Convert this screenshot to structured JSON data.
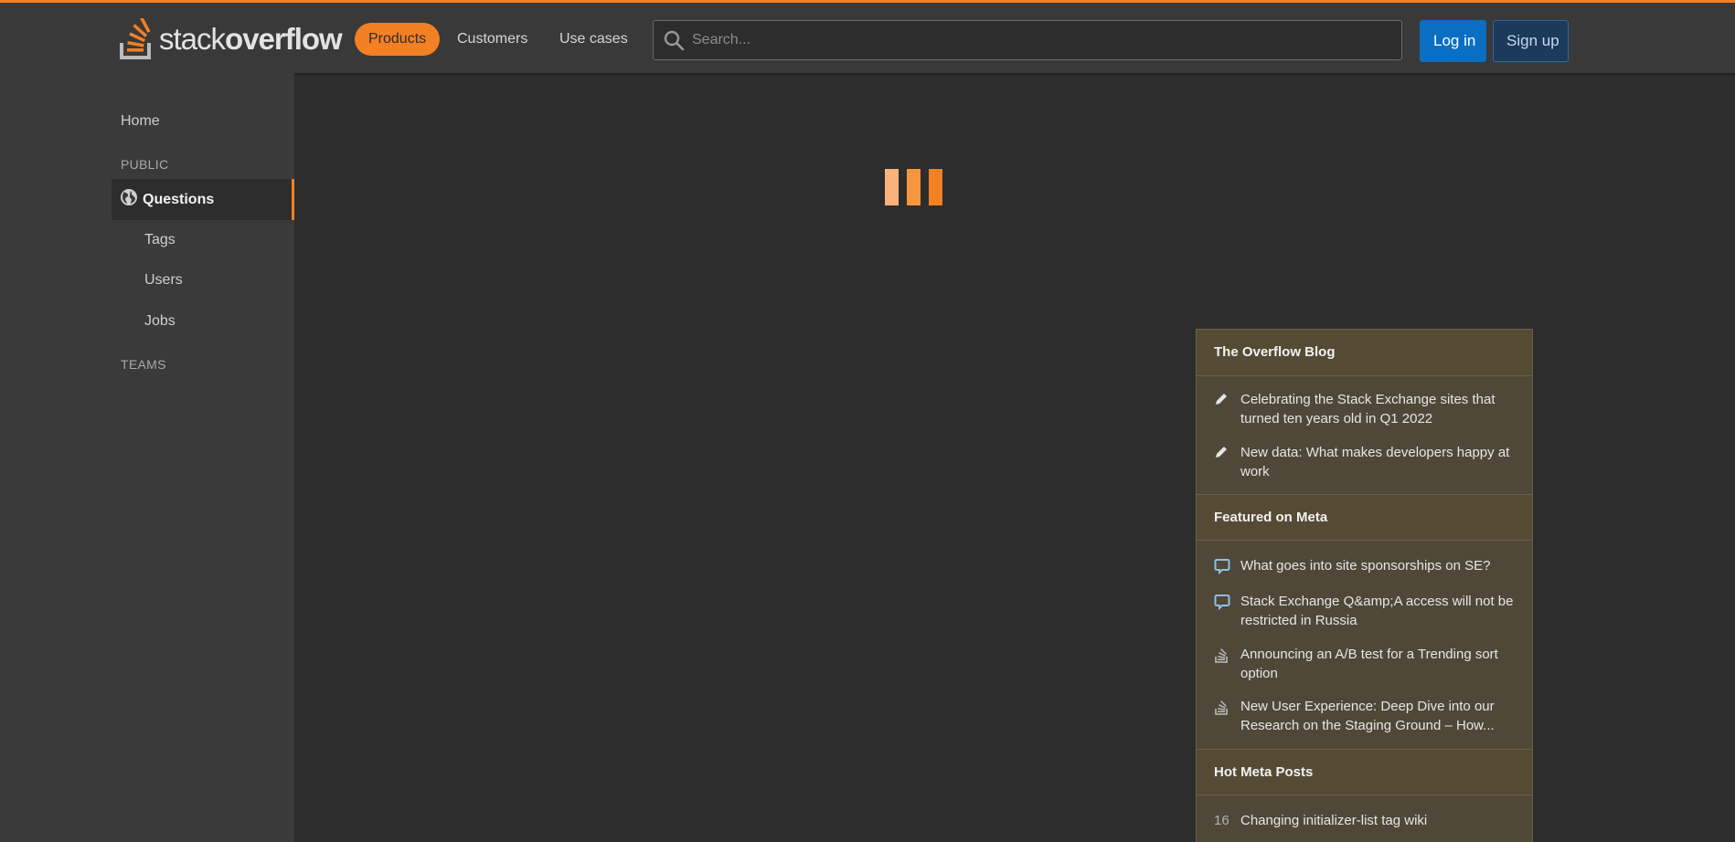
{
  "header": {
    "logo": {
      "text_a": "stack",
      "text_b": "overflow"
    },
    "nav": [
      {
        "label": "Products"
      },
      {
        "label": "Customers"
      },
      {
        "label": "Use cases"
      }
    ],
    "search": {
      "placeholder": "Search..."
    },
    "login_label": "Log in",
    "signup_label": "Sign up"
  },
  "sidebar": {
    "home": "Home",
    "public_section": "PUBLIC",
    "questions": "Questions",
    "tags": "Tags",
    "users": "Users",
    "jobs": "Jobs",
    "teams_section": "TEAMS"
  },
  "colors": {
    "accent": "#f48024",
    "login_blue": "#0a6fc2",
    "widget_bg": "#4f4838"
  },
  "widget": {
    "blog": {
      "title": "The Overflow Blog",
      "items": [
        {
          "icon": "pencil-icon",
          "text": "Celebrating the Stack Exchange sites that turned ten years old in Q1 2022"
        },
        {
          "icon": "pencil-icon",
          "text": "New data: What makes developers happy at work"
        }
      ]
    },
    "meta": {
      "title": "Featured on Meta",
      "items": [
        {
          "icon": "speech-bubble-icon",
          "text": "What goes into site sponsorships on SE?"
        },
        {
          "icon": "speech-bubble-icon",
          "text": "Stack Exchange Q&amp;A access will not be restricted in Russia"
        },
        {
          "icon": "stackoverflow-icon",
          "text": "Announcing an A/B test for a Trending sort option"
        },
        {
          "icon": "stackoverflow-icon",
          "text": "New User Experience: Deep Dive into our Research on the Staging Ground – How..."
        }
      ]
    },
    "hot": {
      "title": "Hot Meta Posts",
      "items": [
        {
          "count": "16",
          "text": "Changing initializer-list tag wiki"
        }
      ]
    }
  }
}
